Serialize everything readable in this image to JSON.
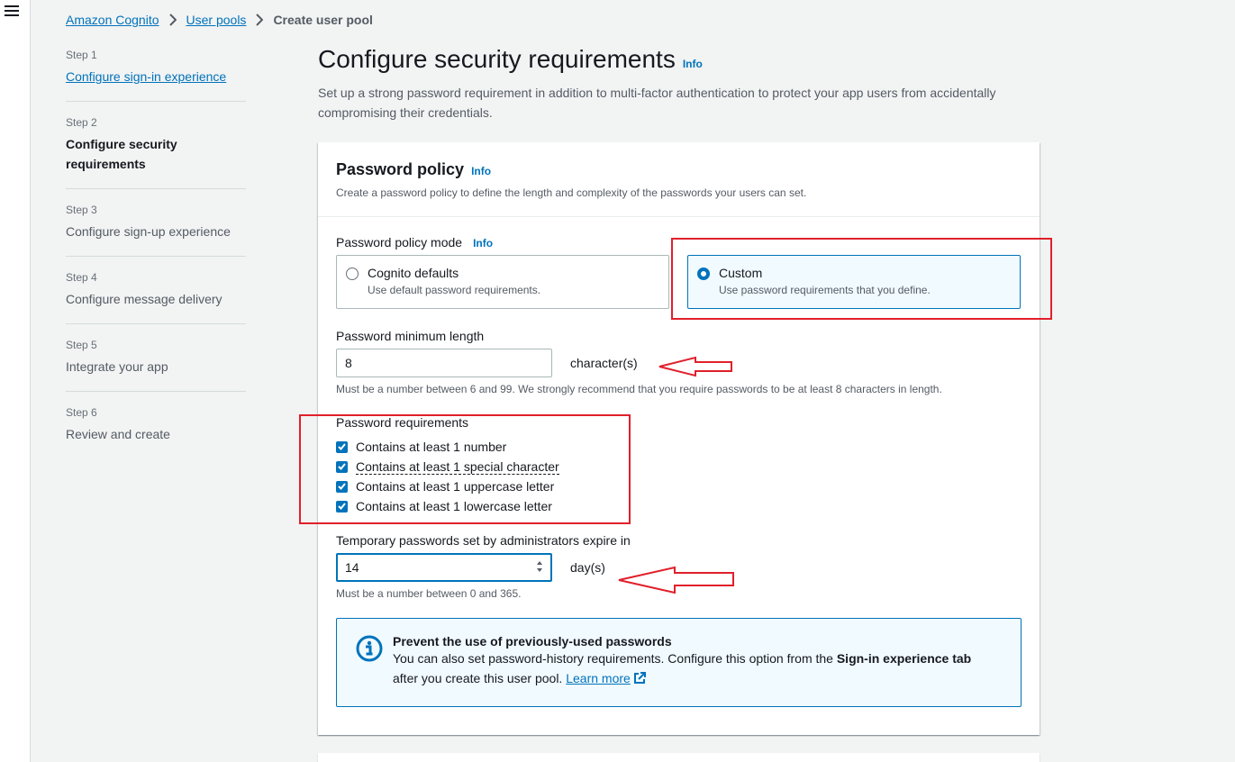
{
  "breadcrumb": {
    "items": [
      "Amazon Cognito",
      "User pools"
    ],
    "current": "Create user pool"
  },
  "steps": [
    {
      "num": "Step 1",
      "title": "Configure sign-in experience"
    },
    {
      "num": "Step 2",
      "title": "Configure security requirements"
    },
    {
      "num": "Step 3",
      "title": "Configure sign-up experience"
    },
    {
      "num": "Step 4",
      "title": "Configure message delivery"
    },
    {
      "num": "Step 5",
      "title": "Integrate your app"
    },
    {
      "num": "Step 6",
      "title": "Review and create"
    }
  ],
  "page": {
    "title": "Configure security requirements",
    "info": "Info",
    "description": "Set up a strong password requirement in addition to multi-factor authentication to protect your app users from accidentally compromising their credentials."
  },
  "password_policy": {
    "title": "Password policy",
    "info": "Info",
    "description": "Create a password policy to define the length and complexity of the passwords your users can set.",
    "mode_label": "Password policy mode",
    "mode_info": "Info",
    "options": [
      {
        "title": "Cognito defaults",
        "desc": "Use default password requirements.",
        "selected": false
      },
      {
        "title": "Custom",
        "desc": "Use password requirements that you define.",
        "selected": true
      }
    ],
    "min_length_label": "Password minimum length",
    "min_length_value": "8",
    "min_length_suffix": "character(s)",
    "min_length_hint": "Must be a number between 6 and 99. We strongly recommend that you require passwords to be at least 8 characters in length.",
    "requirements_label": "Password requirements",
    "requirements": [
      {
        "label": "Contains at least 1 number",
        "checked": true
      },
      {
        "label": "Contains at least 1 special character",
        "checked": true
      },
      {
        "label": "Contains at least 1 uppercase letter",
        "checked": true
      },
      {
        "label": "Contains at least 1 lowercase letter",
        "checked": true
      }
    ],
    "temp_label": "Temporary passwords set by administrators expire in",
    "temp_value": "14",
    "temp_suffix": "day(s)",
    "temp_hint": "Must be a number between 0 and 365.",
    "alert": {
      "title": "Prevent the use of previously-used passwords",
      "text_before": "You can also set password-history requirements. Configure this option from the ",
      "text_bold": "Sign-in experience tab",
      "text_after": "after you create this user pool. ",
      "link": "Learn more"
    }
  },
  "colors": {
    "link": "#0073bb",
    "annotation": "#e0202b"
  },
  "icons": [
    "menu-icon",
    "chevron-right-icon",
    "info-circle-icon",
    "external-link-icon",
    "check-icon",
    "spinner-icon"
  ]
}
